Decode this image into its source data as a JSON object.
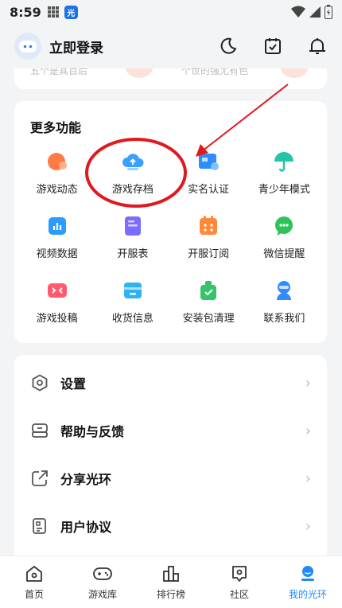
{
  "status_bar": {
    "time": "8:59",
    "app_badge": "光"
  },
  "header": {
    "login_label": "立即登录",
    "icons": [
      "moon-icon",
      "calendar-check-icon",
      "bell-icon"
    ]
  },
  "top_card_faded": {
    "left_text": "五个是其百后",
    "right_text": "个世的强尤有色"
  },
  "more_functions": {
    "title": "更多功能",
    "items": [
      {
        "label": "游戏动态",
        "icon": "game-news-icon",
        "color": "#ff7a45"
      },
      {
        "label": "游戏存档",
        "icon": "cloud-save-icon",
        "color": "#3aa0ff"
      },
      {
        "label": "实名认证",
        "icon": "id-verify-icon",
        "color": "#2f8cff"
      },
      {
        "label": "青少年模式",
        "icon": "umbrella-icon",
        "color": "#23c4a8"
      },
      {
        "label": "视频数据",
        "icon": "video-data-icon",
        "color": "#2b9bff"
      },
      {
        "label": "开服表",
        "icon": "server-list-icon",
        "color": "#7a6cff"
      },
      {
        "label": "开服订阅",
        "icon": "subscribe-icon",
        "color": "#ff8a3d"
      },
      {
        "label": "微信提醒",
        "icon": "wechat-icon",
        "color": "#2fc25b"
      },
      {
        "label": "游戏投稿",
        "icon": "game-submit-icon",
        "color": "#ff5a6e"
      },
      {
        "label": "收货信息",
        "icon": "delivery-icon",
        "color": "#2fb3f0"
      },
      {
        "label": "安装包清理",
        "icon": "cleaner-icon",
        "color": "#35c46a"
      },
      {
        "label": "联系我们",
        "icon": "contact-icon",
        "color": "#2f8cff"
      }
    ]
  },
  "menu": {
    "items": [
      {
        "label": "设置",
        "icon": "settings-icon"
      },
      {
        "label": "帮助与反馈",
        "icon": "help-icon"
      },
      {
        "label": "分享光环",
        "icon": "share-icon"
      },
      {
        "label": "用户协议",
        "icon": "agreement-icon"
      }
    ],
    "chevron": "›"
  },
  "tabbar": {
    "items": [
      {
        "label": "首页",
        "icon": "home-icon",
        "active": false
      },
      {
        "label": "游戏库",
        "icon": "gamepad-icon",
        "active": false
      },
      {
        "label": "排行榜",
        "icon": "ranking-icon",
        "active": false
      },
      {
        "label": "社区",
        "icon": "community-icon",
        "active": false
      },
      {
        "label": "我的光环",
        "icon": "profile-icon",
        "active": true
      }
    ]
  },
  "colors": {
    "accent": "#1e88ff",
    "annotation": "#e0191f"
  }
}
